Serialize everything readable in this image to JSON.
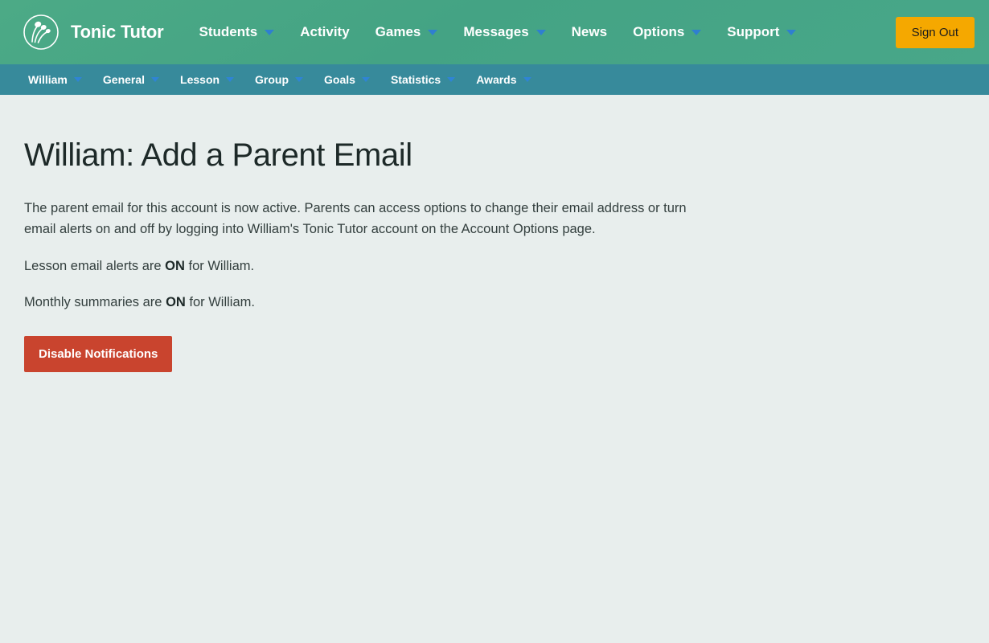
{
  "header": {
    "brand_name": "Tonic Tutor",
    "logo_icon": "tonic-tutor-circle-notes-logo",
    "nav": [
      {
        "label": "Students",
        "has_dropdown": true
      },
      {
        "label": "Activity",
        "has_dropdown": false
      },
      {
        "label": "Games",
        "has_dropdown": true
      },
      {
        "label": "Messages",
        "has_dropdown": true
      },
      {
        "label": "News",
        "has_dropdown": false
      },
      {
        "label": "Options",
        "has_dropdown": true
      },
      {
        "label": "Support",
        "has_dropdown": true
      }
    ],
    "sign_out_label": "Sign Out"
  },
  "subnav": {
    "items": [
      {
        "label": "William",
        "has_dropdown": true
      },
      {
        "label": "General",
        "has_dropdown": true
      },
      {
        "label": "Lesson",
        "has_dropdown": true
      },
      {
        "label": "Group",
        "has_dropdown": true
      },
      {
        "label": "Goals",
        "has_dropdown": true
      },
      {
        "label": "Statistics",
        "has_dropdown": true
      },
      {
        "label": "Awards",
        "has_dropdown": true
      }
    ]
  },
  "main": {
    "page_title": "William: Add a Parent Email",
    "intro_paragraph": "The parent email for this account is now active. Parents can access options to change their email address or turn email alerts on and off by logging into William's Tonic Tutor account on the Account Options page.",
    "lesson_alerts": {
      "prefix": "Lesson email alerts are ",
      "state": "ON",
      "suffix": " for William."
    },
    "monthly_summaries": {
      "prefix": "Monthly summaries are ",
      "state": "ON",
      "suffix": " for William."
    },
    "disable_button_label": "Disable Notifications"
  },
  "colors": {
    "header_green": "#47a687",
    "subnav_teal": "#378a9b",
    "page_background": "#e8eeed",
    "signout_amber": "#f5a800",
    "danger_red": "#c9442e",
    "caret_blue": "#2f7fd0"
  }
}
